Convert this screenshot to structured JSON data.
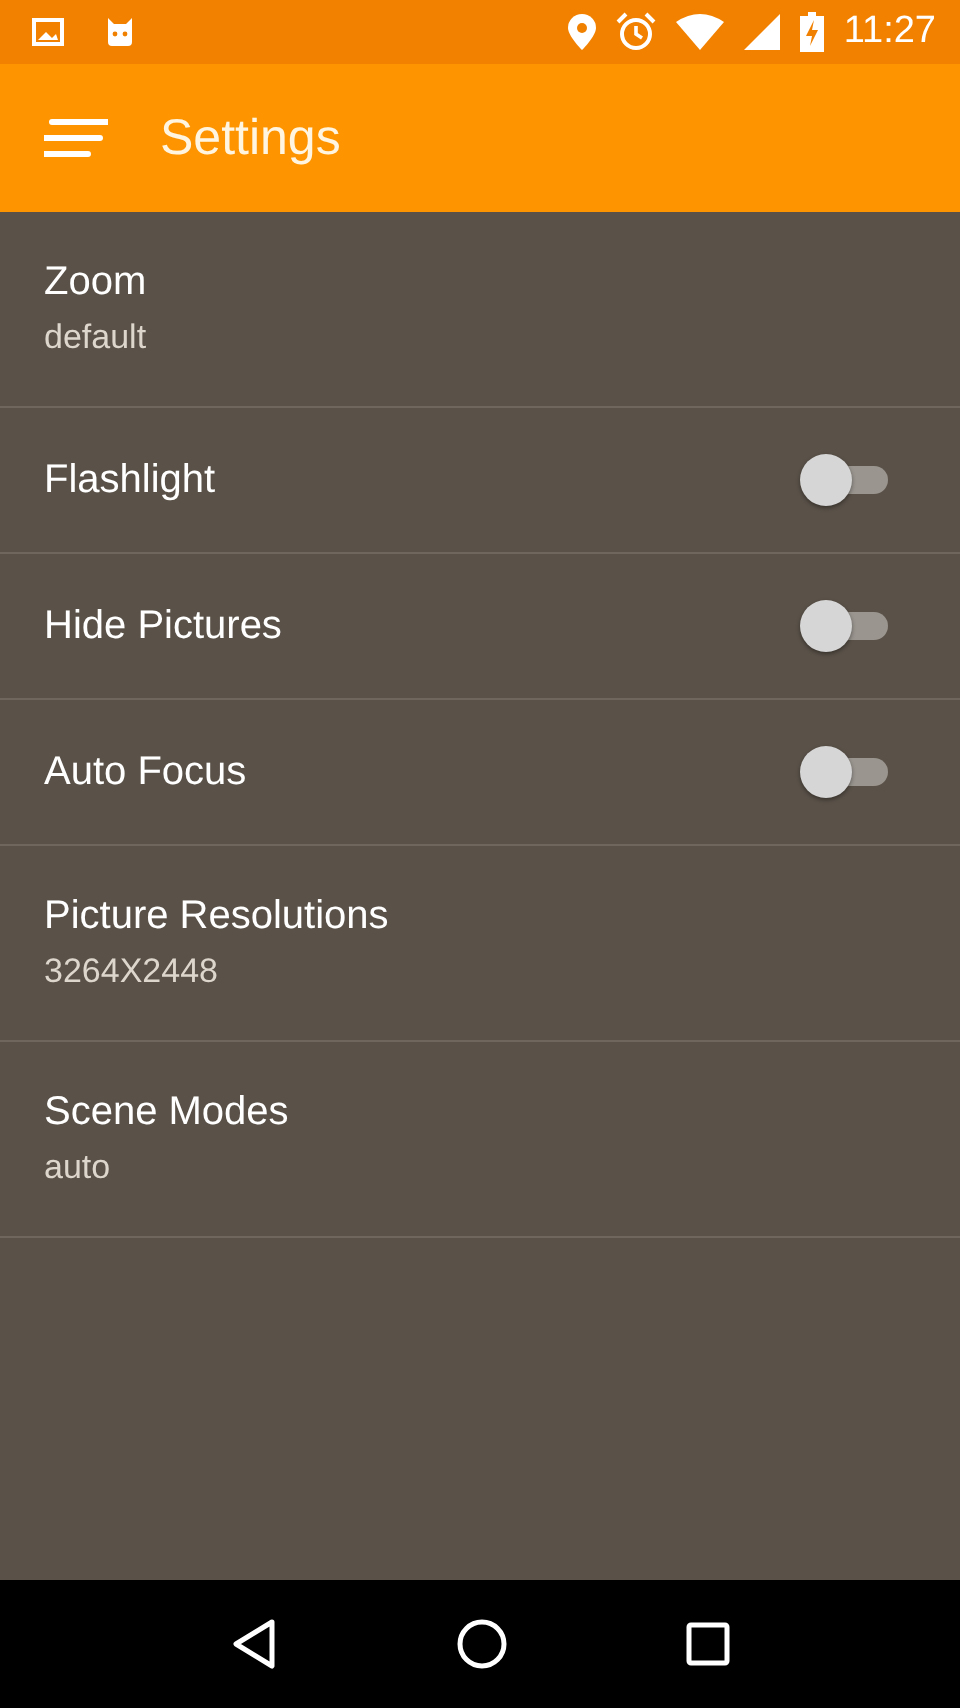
{
  "status_bar": {
    "time": "11:27"
  },
  "app_bar": {
    "title": "Settings"
  },
  "settings": [
    {
      "kind": "detail",
      "title": "Zoom",
      "value": "default"
    },
    {
      "kind": "switch",
      "title": "Flashlight",
      "on": false
    },
    {
      "kind": "switch",
      "title": "Hide Pictures",
      "on": false
    },
    {
      "kind": "switch",
      "title": "Auto Focus",
      "on": false
    },
    {
      "kind": "detail",
      "title": "Picture Resolutions",
      "value": "3264X2448"
    },
    {
      "kind": "detail",
      "title": "Scene Modes",
      "value": "auto"
    }
  ]
}
